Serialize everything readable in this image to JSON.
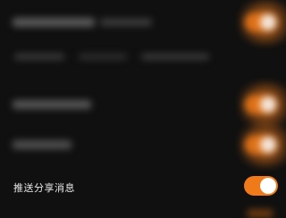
{
  "settings": {
    "share_push": {
      "label": "推送分享消息",
      "enabled": true
    }
  },
  "colors": {
    "background": "#101010",
    "toggle_on": "#f07a1a",
    "toggle_knob": "#ffffff",
    "text": "#e8e8e8"
  }
}
